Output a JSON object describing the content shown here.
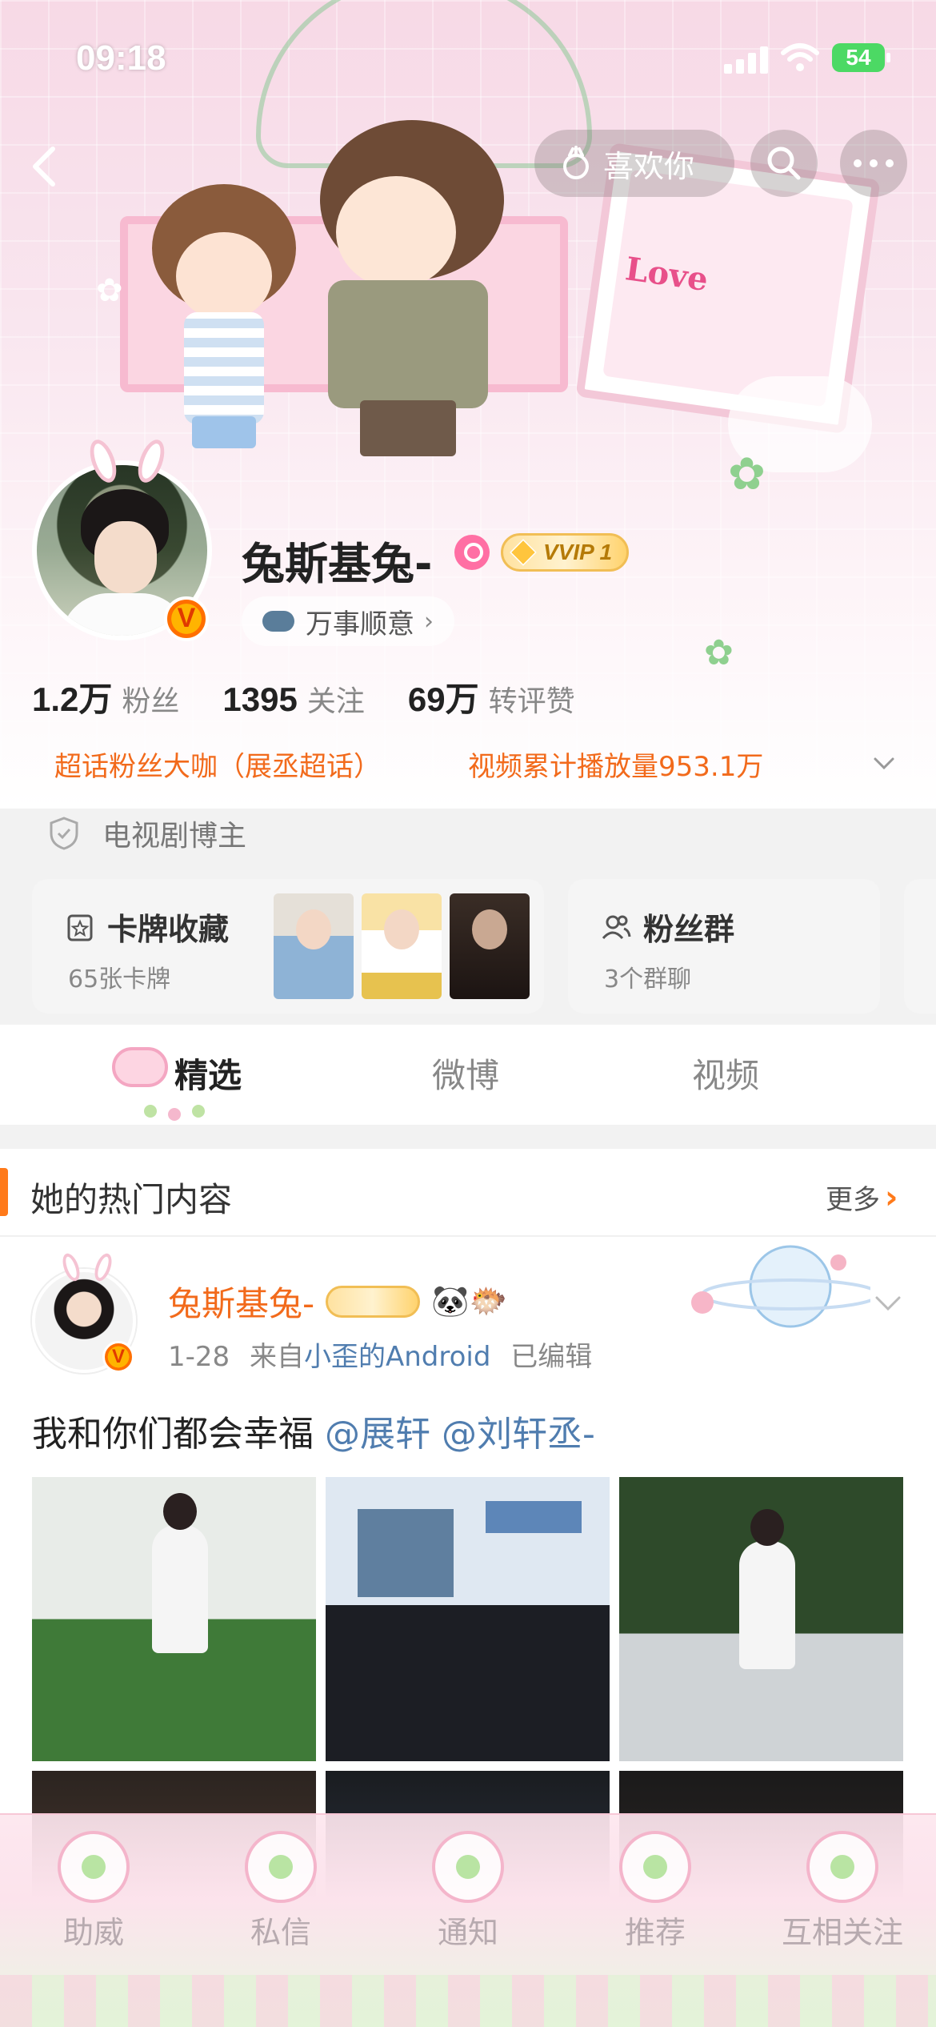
{
  "status_bar": {
    "time": "09:18",
    "battery": "54"
  },
  "top_nav": {
    "like_label": "喜欢你"
  },
  "profile": {
    "name": "兔斯基兔-",
    "vip_label": "VVIP 1",
    "mood": "万事顺意",
    "stats": [
      {
        "num": "1.2万",
        "label": "粉丝"
      },
      {
        "num": "1395",
        "label": "关注"
      },
      {
        "num": "69万",
        "label": "转评赞"
      }
    ],
    "tag_left": "超话粉丝大咖（展丞超话）",
    "tag_right": "视频累计播放量953.1万",
    "blogger": "电视剧博主"
  },
  "cards": [
    {
      "title": "卡牌收藏",
      "sub": "65张卡牌"
    },
    {
      "title": "粉丝群",
      "sub": "3个群聊"
    }
  ],
  "tabs": [
    "精选",
    "微博",
    "视频"
  ],
  "section": {
    "title": "她的热门内容",
    "more": "更多"
  },
  "post": {
    "name": "兔斯基兔-",
    "emojis": "🐼🐡",
    "date": "1-28",
    "from_prefix": "来自",
    "source": "小歪的Android",
    "edited": "已编辑",
    "text": "我和你们都会幸福",
    "mention1": "@展轩",
    "mention2": "@刘轩丞-"
  },
  "bottom_bar": [
    "助威",
    "私信",
    "通知",
    "推荐",
    "互相关注"
  ],
  "colors": {
    "accent": "#f26a1b",
    "link": "#507daf",
    "vip_gold": "#ffd36e"
  }
}
